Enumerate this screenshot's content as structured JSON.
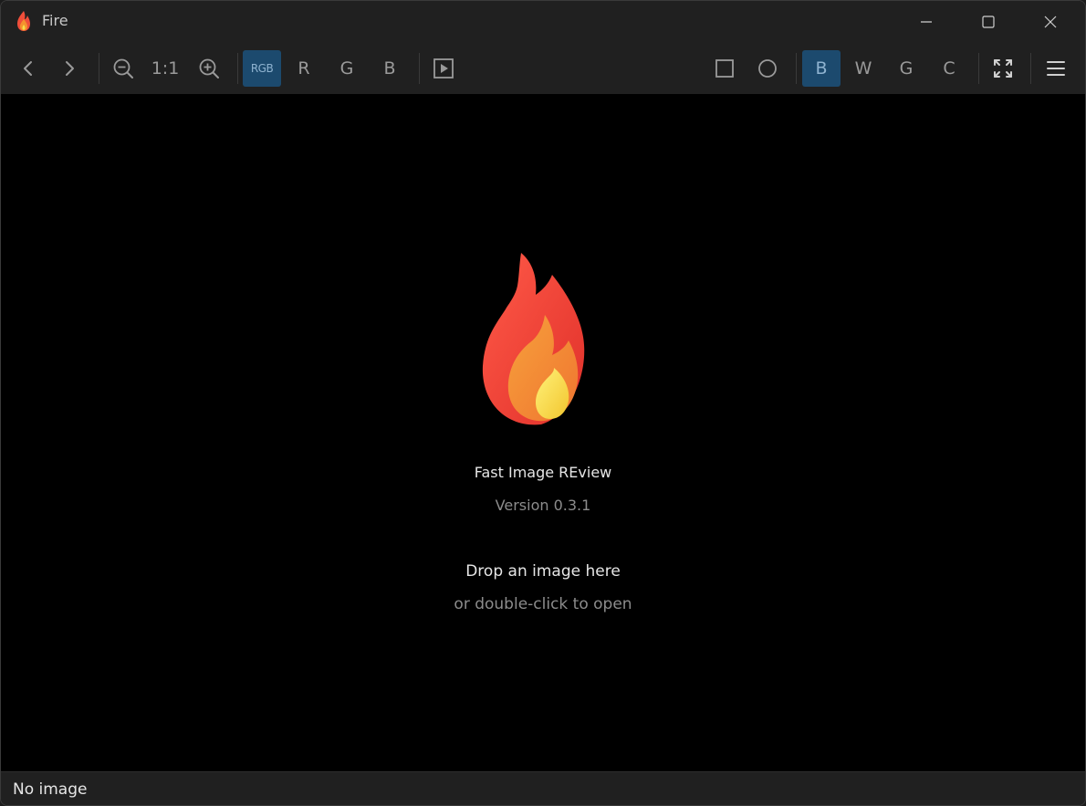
{
  "window": {
    "title": "Fire"
  },
  "toolbar": {
    "zoom_reset_label": "1:1",
    "channels": [
      {
        "label": "RGB",
        "active": true
      },
      {
        "label": "R",
        "active": false
      },
      {
        "label": "G",
        "active": false
      },
      {
        "label": "B",
        "active": false
      }
    ],
    "backgrounds": [
      {
        "label": "B",
        "active": true
      },
      {
        "label": "W",
        "active": false
      },
      {
        "label": "G",
        "active": false
      },
      {
        "label": "C",
        "active": false
      }
    ],
    "icons": {
      "back": "chevron-left-icon",
      "forward": "chevron-right-icon",
      "zoom_out": "zoom-out-icon",
      "zoom_in": "zoom-in-icon",
      "slideshow": "play-icon",
      "square": "square-icon",
      "circle": "circle-icon",
      "fit": "fit-screen-icon",
      "menu": "hamburger-menu-icon"
    }
  },
  "welcome": {
    "app_name": "Fast Image REview",
    "version": "Version 0.3.1",
    "drop_hint": "Drop an image here",
    "open_hint": "or double-click to open"
  },
  "status": {
    "text": "No image"
  },
  "colors": {
    "accent_active": "#1c4a6e",
    "background": "#000000",
    "chrome": "#202020"
  }
}
